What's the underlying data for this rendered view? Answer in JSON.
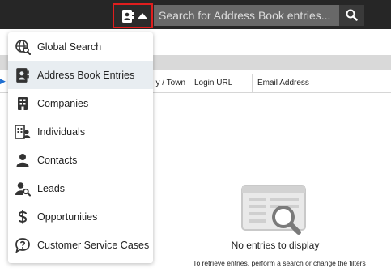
{
  "topbar": {
    "search_placeholder": "Search for Address Book entries...",
    "scope_icon": "address-book-icon",
    "search_icon": "search-icon"
  },
  "scope_menu": {
    "items": [
      {
        "label": "Global Search",
        "icon": "global-search-icon"
      },
      {
        "label": "Address Book Entries",
        "icon": "address-book-icon",
        "selected": true
      },
      {
        "label": "Companies",
        "icon": "building-icon"
      },
      {
        "label": "Individuals",
        "icon": "individuals-icon"
      },
      {
        "label": "Contacts",
        "icon": "person-icon"
      },
      {
        "label": "Leads",
        "icon": "person-search-icon"
      },
      {
        "label": "Opportunities",
        "icon": "dollar-icon"
      },
      {
        "label": "Customer Service Cases",
        "icon": "question-bubble-icon"
      }
    ]
  },
  "grid": {
    "columns": [
      "y / Town",
      "Login URL",
      "Email Address"
    ]
  },
  "empty_state": {
    "title": "No entries to display",
    "hint": "To retrieve entries, perform a search or change the filters"
  },
  "colors": {
    "topbar": "#262626",
    "search_field": "#686868",
    "highlight_border": "#e01e1e",
    "selected_item": "#e8edf1"
  }
}
